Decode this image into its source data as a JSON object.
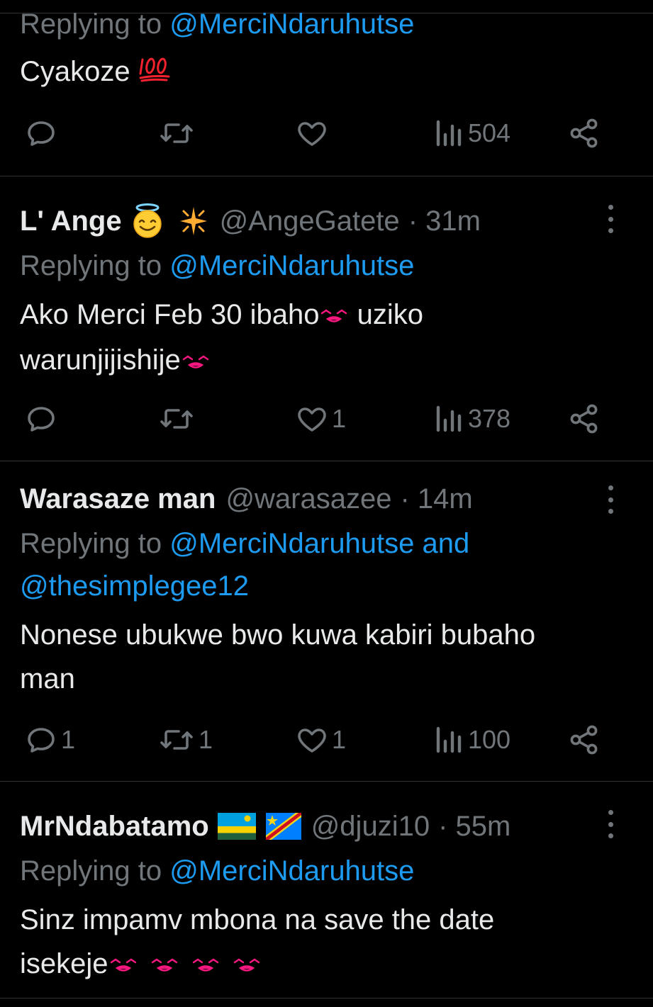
{
  "tweets": [
    {
      "reply_prefix": "Replying to ",
      "reply_to": "@MerciNdaruhutse",
      "text": "Cyakoze",
      "text_emoji": "💯",
      "actions": {
        "replies": "",
        "retweets": "",
        "likes": "",
        "views": "504"
      }
    },
    {
      "name": "L' Ange",
      "handle": "@AngeGatete",
      "time": "· 31m",
      "reply_prefix": "Replying to ",
      "reply_to": "@MerciNdaruhutse",
      "text_line1": "Ako Merci Feb 30 ibaho",
      "text_line1b": " uziko",
      "text_line2": "warunjijishije",
      "actions": {
        "replies": "",
        "retweets": "",
        "likes": "1",
        "views": "378"
      }
    },
    {
      "name": "Warasaze man",
      "handle": "@warasazee",
      "time": "· 14m",
      "reply_prefix": "Replying to ",
      "reply_to": "@MerciNdaruhutse and",
      "reply_to_2": "@thesimplegee12",
      "text_line1": "Nonese ubukwe bwo kuwa kabiri bubaho",
      "text_line2": "man",
      "actions": {
        "replies": "1",
        "retweets": "1",
        "likes": "1",
        "views": "100"
      }
    },
    {
      "name": "MrNdabatamo",
      "handle": "@djuzi10",
      "time": "· 55m",
      "reply_prefix": "Replying to ",
      "reply_to": "@MerciNdaruhutse",
      "text_line1": "Sinz impamv mbona na save the date",
      "text_line2": "isekeje",
      "actions": {
        "replies": "",
        "retweets": "",
        "likes": "",
        "views": ""
      }
    }
  ],
  "icons": [
    "reply-icon",
    "retweet-icon",
    "like-icon",
    "views-icon",
    "share-icon",
    "more-icon",
    "halo-emoji-icon",
    "sparkle-emoji-icon",
    "rwanda-flag-icon",
    "drc-flag-icon",
    "kiss-emoji-icon",
    "hundred-emoji-icon"
  ],
  "colors": {
    "background": "#000000",
    "text": "#e7e9ea",
    "muted": "#71767b",
    "link": "#1d9bf0",
    "divider": "#2f3336",
    "kiss": "#f91880"
  }
}
